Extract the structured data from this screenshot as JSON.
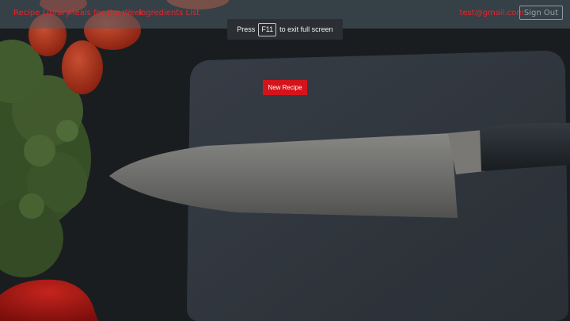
{
  "navbar": {
    "links": [
      "Recipe Library",
      "Meals for the Week",
      "Ingredients List"
    ],
    "user_email": "test@gmail.com",
    "sign_out_label": "Sign Out"
  },
  "fullscreen_toast": {
    "prefix": "Press",
    "key": "F11",
    "suffix": "to exit full screen"
  },
  "main": {
    "new_recipe_label": "New Recipe"
  },
  "colors": {
    "accent": "#e3262b",
    "button": "#d4141b",
    "navbar": "#4e5c68"
  }
}
